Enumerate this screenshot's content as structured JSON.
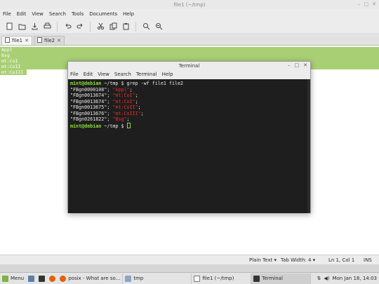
{
  "gedit": {
    "title": "file1 (~/tmp)",
    "menu": [
      "File",
      "Edit",
      "View",
      "Search",
      "Tools",
      "Documents",
      "Help"
    ],
    "toolbar": [
      "new-document-icon",
      "open-icon",
      "save-icon",
      "print-icon",
      "undo-icon",
      "redo-icon",
      "cut-icon",
      "copy-icon",
      "paste-icon",
      "search-icon",
      "replace-icon"
    ],
    "tabs": [
      {
        "label": "file1",
        "active": true
      },
      {
        "label": "file2",
        "active": false
      }
    ],
    "lines": [
      "Appl",
      "Bsg",
      "mt:CoI",
      "mt:CoII",
      "mt:CoIII"
    ],
    "highlight_color": "#a9cf74",
    "status": {
      "language": "Plain Text ▾",
      "tab_width": "Tab Width: 4 ▾",
      "position": "Ln 1, Col 1",
      "mode": "INS"
    }
  },
  "terminal": {
    "title": "Terminal",
    "menu": [
      "File",
      "Edit",
      "View",
      "Search",
      "Terminal",
      "Help"
    ],
    "prompt": "mint@debian",
    "cwd": " ~/tmp $ ",
    "command": "grep -wf file1 file2",
    "output": [
      {
        "id": "\"FBgn0000108\"; ",
        "match": "\"Appl\"",
        "tail": ";"
      },
      {
        "id": "\"FBgn0013674\"; ",
        "match": "\"mt:CoI\"",
        "tail": ";"
      },
      {
        "id": "\"FBgn0013674\"; ",
        "match": "\"mt:CoI\"",
        "tail": ";"
      },
      {
        "id": "\"FBgn0013675\"; ",
        "match": "\"mt:CoII\"",
        "tail": ";"
      },
      {
        "id": "\"FBgn0013676\"; ",
        "match": "\"mt:CoIII\"",
        "tail": ";"
      },
      {
        "id": "\"FBgn0261822\"; ",
        "match": "\"Bsg\"",
        "tail": ";"
      }
    ],
    "prompt_color": "#8ae234",
    "match_color": "#ef2929"
  },
  "panel": {
    "menu_label": "Menu",
    "tasks": [
      {
        "label": "posix - What are so...",
        "active": false
      },
      {
        "label": "tmp",
        "active": false
      },
      {
        "label": "file1 (~/tmp)",
        "active": false
      },
      {
        "label": "Terminal",
        "active": true
      }
    ],
    "clock": "Mon Jan 18, 14:03"
  }
}
